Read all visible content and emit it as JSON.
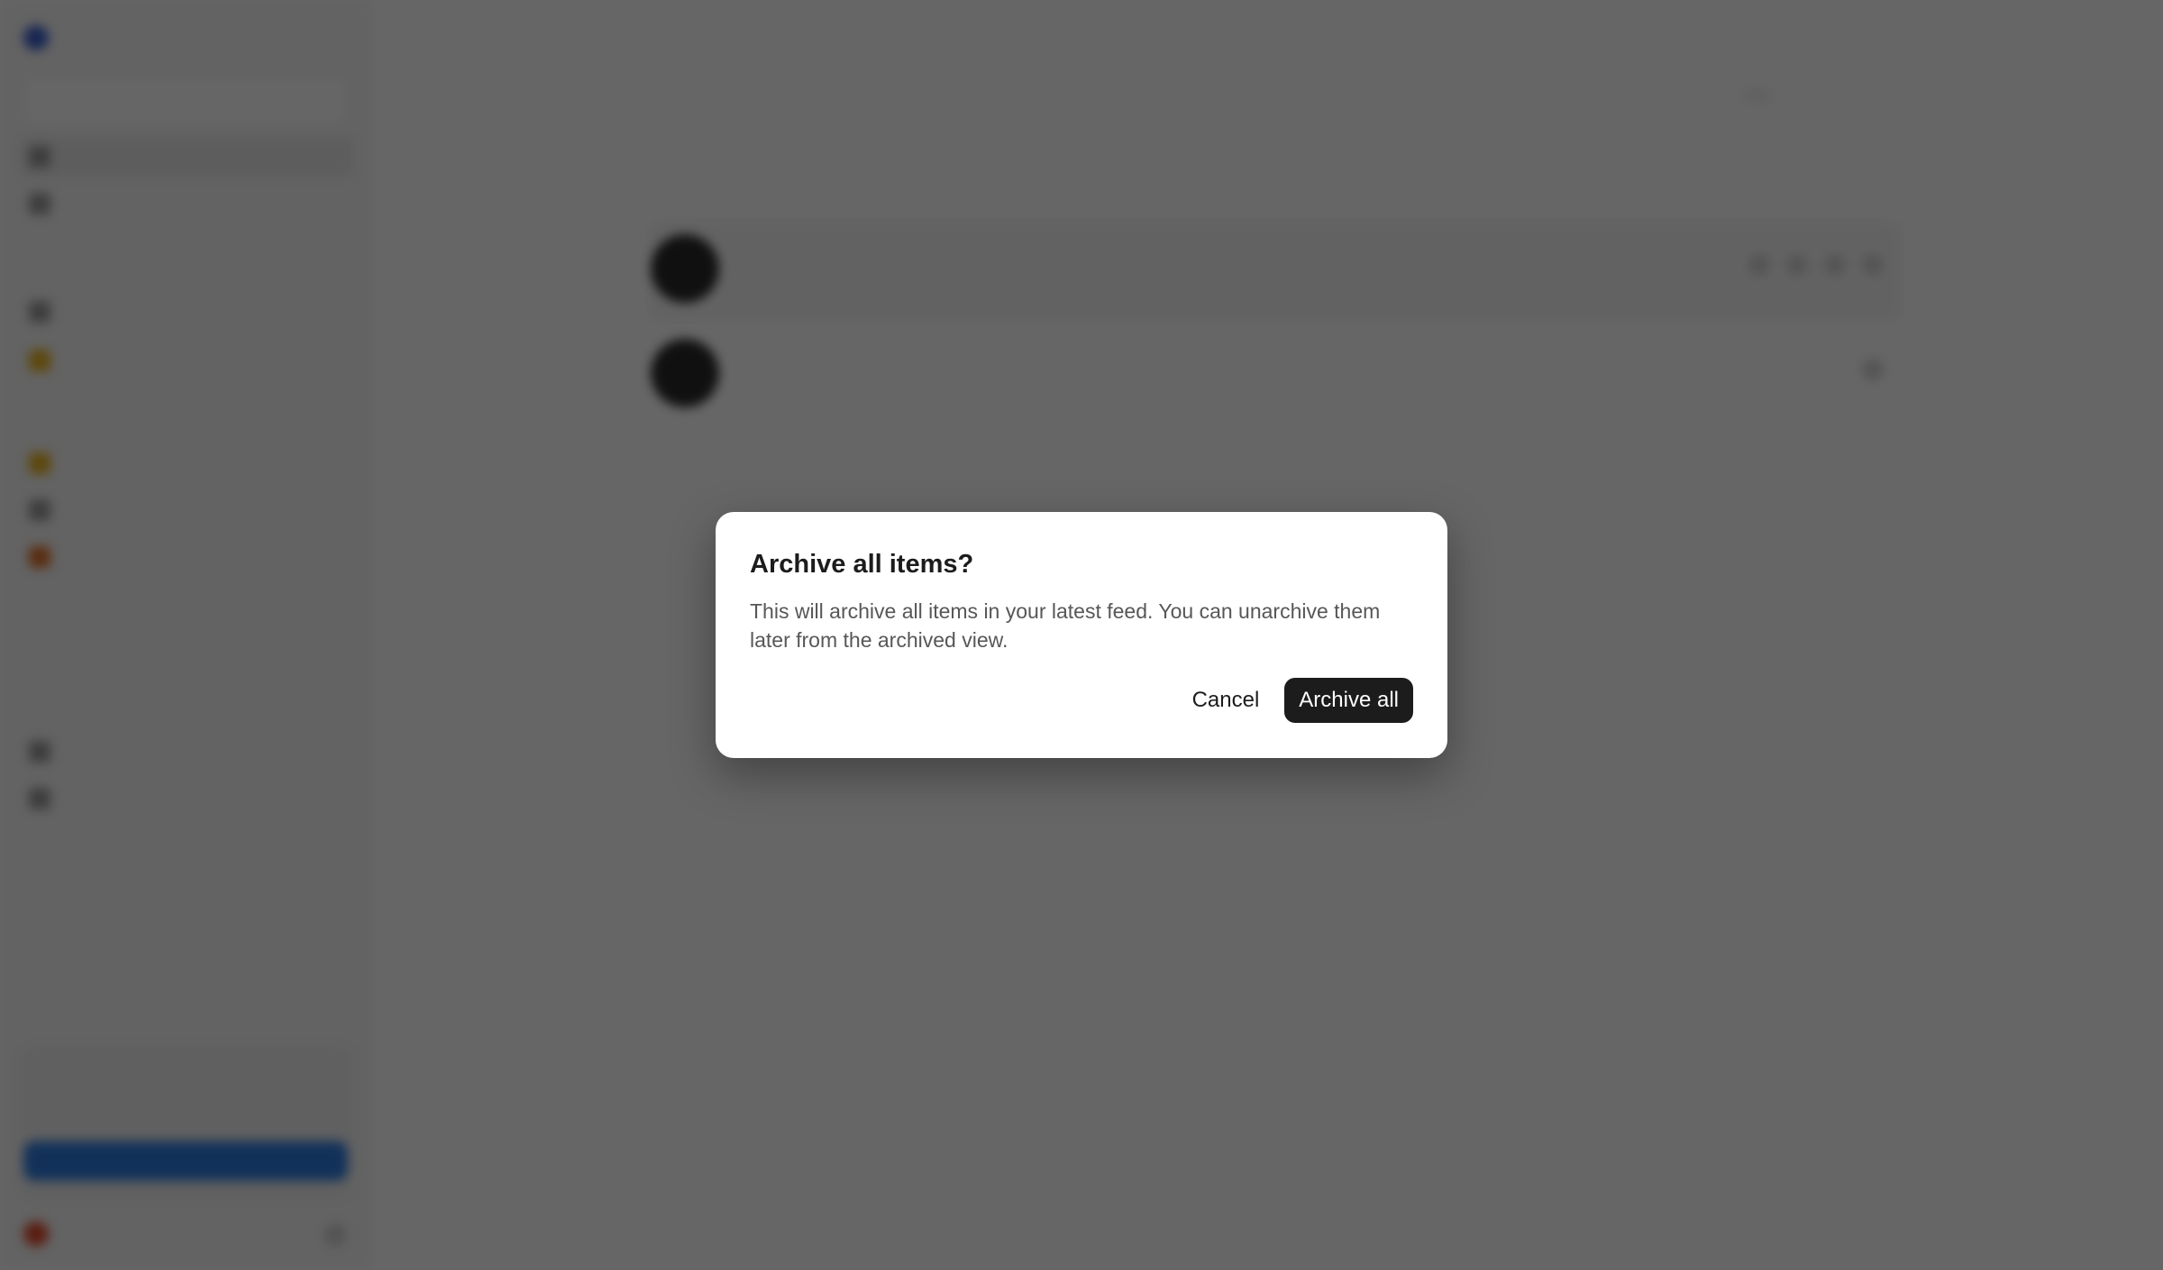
{
  "dialog": {
    "title": "Archive all items?",
    "body": "This will archive all items in your latest feed. You can unarchive them later from the archived view.",
    "cancel_label": "Cancel",
    "confirm_label": "Archive all"
  },
  "colors": {
    "overlay": "#000000",
    "dialog_background": "#ffffff",
    "primary_button": "#1c1c1c",
    "primary_button_text": "#ffffff"
  }
}
